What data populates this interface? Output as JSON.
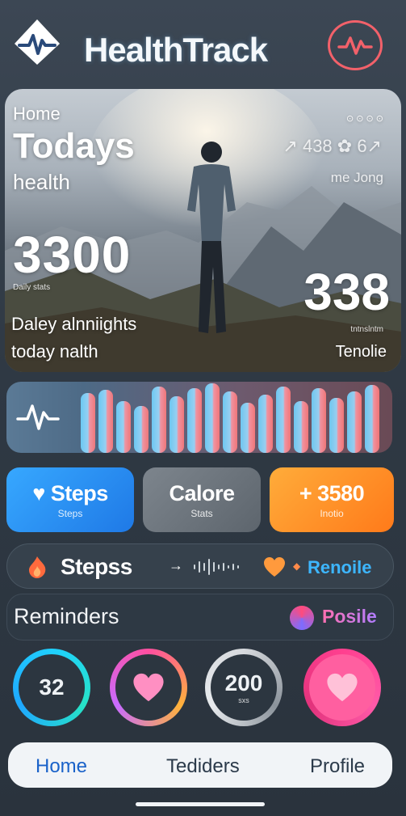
{
  "app": {
    "title": "HealthTrack"
  },
  "icons": {
    "logo": "heart-pulse-icon",
    "header_button": "pulse-icon",
    "wave": "pulse-icon",
    "bar": "flame-icon",
    "reminders": "profile-icon"
  },
  "colors": {
    "accent_blue": "#1f79e6",
    "accent_orange": "#ff7a1a",
    "accent_pink": "#ff4fa0",
    "accent_red": "#f2616a"
  },
  "hero": {
    "small_label": "Home",
    "title": "Todays",
    "subtitle": "health",
    "big_value_left": "3300",
    "caption_left": "Daily stats",
    "line1": "Daley alnniights",
    "line2": "today nalth",
    "right_top": "⊙ ⊙ ⊙ ⊙",
    "right_mid": "↗ 438 ✿ 6↗",
    "right_sub": "me Jong",
    "big_value_right": "338",
    "caption_right": "tntnslntm",
    "right_label": "Tenolie"
  },
  "tiles": [
    {
      "label": "Steps",
      "sub": "Steps",
      "icon": "heart-icon"
    },
    {
      "label": "Calore",
      "sub": "Stats"
    },
    {
      "label": "+ 3580",
      "sub": "Inotio"
    }
  ],
  "bar": {
    "label": "Stepss",
    "arrow": "→",
    "right": "Renoile"
  },
  "reminders": {
    "title": "Reminders",
    "profile": "Posile"
  },
  "rings": [
    {
      "value": "32",
      "sub": ""
    },
    {
      "value": "",
      "sub": "",
      "icon": "heart-icon"
    },
    {
      "value": "200",
      "sub": "sxs"
    },
    {
      "value": "",
      "sub": "",
      "icon": "heart-icon"
    }
  ],
  "nav": {
    "home": "Home",
    "middle": "Tediders",
    "profile": "Profile"
  }
}
